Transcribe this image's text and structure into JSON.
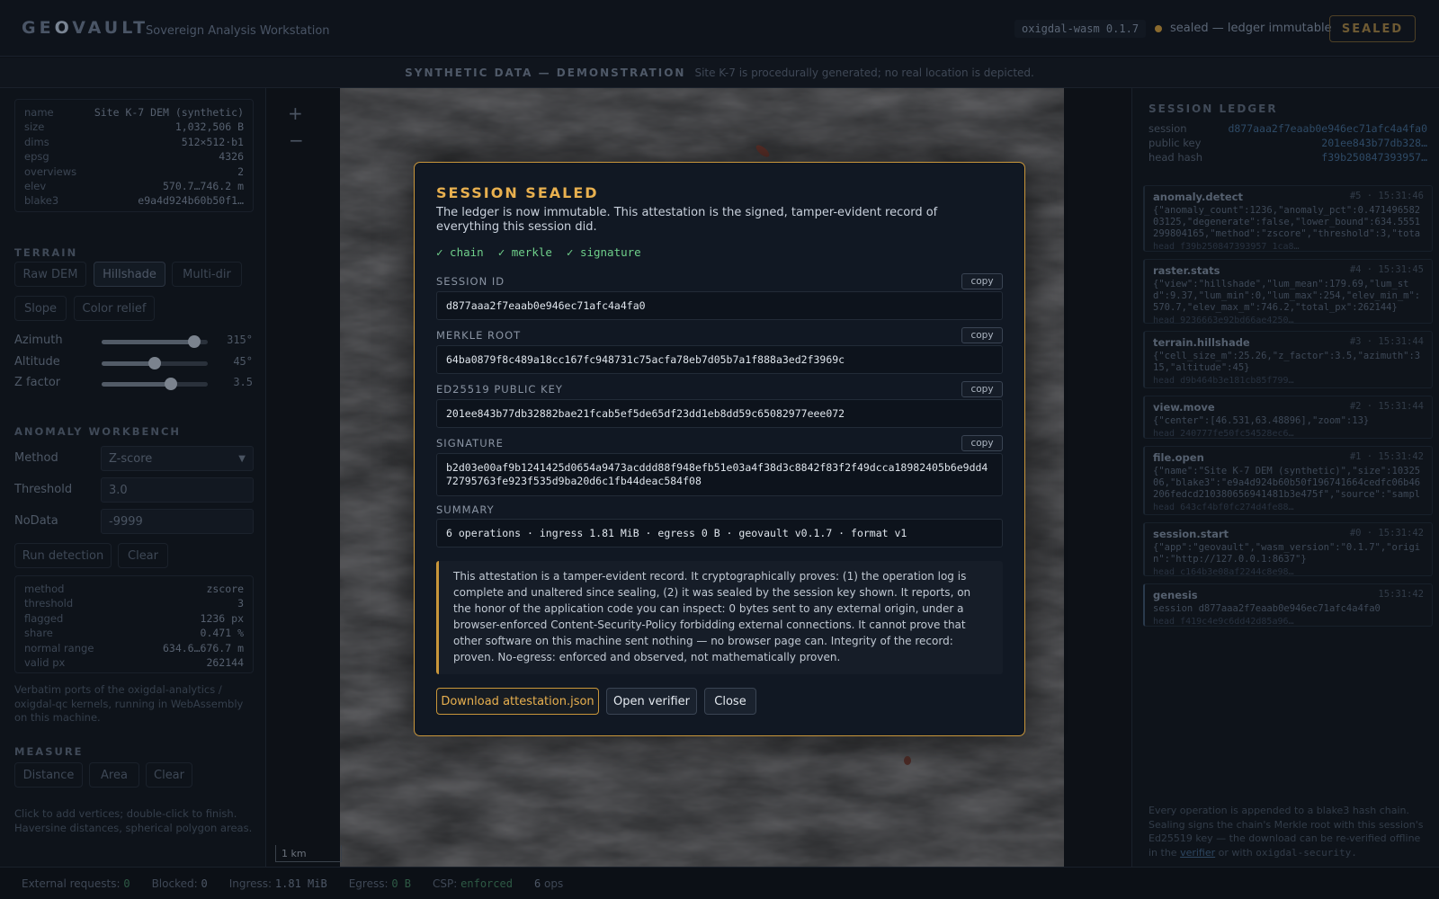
{
  "header": {
    "logo_a": "GE",
    "logo_o": "O",
    "logo_b": "VAULT",
    "subtitle": "Sovereign Analysis Workstation",
    "version_badge": "oxigdal-wasm 0.1.7",
    "status_text": "sealed — ledger immutable",
    "sealed_label": "SEALED"
  },
  "banner": {
    "title": "SYNTHETIC DATA — DEMONSTRATION",
    "text": "Site K-7 is procedurally generated; no real location is depicted."
  },
  "file_meta": [
    {
      "k": "name",
      "v": "Site K-7 DEM (synthetic)"
    },
    {
      "k": "size",
      "v": "1,032,506 B"
    },
    {
      "k": "dims",
      "v": "512×512·b1"
    },
    {
      "k": "epsg",
      "v": "4326"
    },
    {
      "k": "overviews",
      "v": "2"
    },
    {
      "k": "elev",
      "v": "570.7…746.2 m"
    },
    {
      "k": "blake3",
      "v": "e9a4d924b60b50f1…"
    }
  ],
  "terrain": {
    "title": "TERRAIN",
    "modes": [
      "Raw DEM",
      "Hillshade",
      "Multi-dir",
      "Slope",
      "Color relief"
    ],
    "azimuth_label": "Azimuth",
    "azimuth_value": "315°",
    "azimuth_frac": 0.875,
    "altitude_label": "Altitude",
    "altitude_value": "45°",
    "altitude_frac": 0.5,
    "zfactor_label": "Z factor",
    "zfactor_value": "3.5",
    "zfactor_frac": 0.65
  },
  "anomaly": {
    "title": "ANOMALY WORKBENCH",
    "method_label": "Method",
    "method_value": "Z-score",
    "threshold_label": "Threshold",
    "threshold_value": "3.0",
    "nodata_label": "NoData",
    "nodata_value": "-9999",
    "run_label": "Run detection",
    "clear_label": "Clear",
    "results": [
      {
        "k": "method",
        "v": "zscore"
      },
      {
        "k": "threshold",
        "v": "3"
      },
      {
        "k": "flagged",
        "v": "1236 px"
      },
      {
        "k": "share",
        "v": "0.471 %"
      },
      {
        "k": "normal range",
        "v": "634.6…676.7 m"
      },
      {
        "k": "valid px",
        "v": "262144"
      }
    ],
    "note": "Verbatim ports of the oxigdal-analytics / oxigdal-qc kernels, running in WebAssembly on this machine."
  },
  "measure": {
    "title": "MEASURE",
    "distance_label": "Distance",
    "area_label": "Area",
    "clear_label": "Clear",
    "note": "Click to add vertices; double-click to finish. Haversine distances, spherical polygon areas."
  },
  "map": {
    "zoom_in": "+",
    "zoom_out": "−",
    "scale_label": "1 km"
  },
  "ledger": {
    "title": "SESSION LEDGER",
    "session_label": "session",
    "session_value": "d877aaa2f7eaab0e946ec71afc4a4fa0",
    "pubkey_label": "public key",
    "pubkey_value": "201ee843b77db328…",
    "headhash_label": "head hash",
    "headhash_value": "f39b250847393957…",
    "entries": [
      {
        "op": "anomaly.detect",
        "meta": "#5 · 15:31:46",
        "payload": "{\"anomaly_count\":1236,\"anomaly_pct\":0.471496582 03125,\"degenerate\":false,\"lower_bound\":634.5551 299804165,\"method\":\"zscore\",\"threshold\":3,\"tota",
        "head": "head f39b250847393957 1ca8…"
      },
      {
        "op": "raster.stats",
        "meta": "#4 · 15:31:45",
        "payload": "{\"view\":\"hillshade\",\"lum_mean\":179.69,\"lum_st d\":9.37,\"lum_min\":0,\"lum_max\":254,\"elev_min_m\": 570.7,\"elev_max_m\":746.2,\"total_px\":262144}",
        "head": "head 9236663e92bd66ae4250…"
      },
      {
        "op": "terrain.hillshade",
        "meta": "#3 · 15:31:44",
        "payload": "{\"cell_size_m\":25.26,\"z_factor\":3.5,\"azimuth\":3 15,\"altitude\":45}",
        "head": "head d9b464b3e181cb85f799…"
      },
      {
        "op": "view.move",
        "meta": "#2 · 15:31:44",
        "payload": "{\"center\":[46.531,63.48896],\"zoom\":13}",
        "head": "head 240777fe50fc54528ec6…"
      },
      {
        "op": "file.open",
        "meta": "#1 · 15:31:42",
        "payload": "{\"name\":\"Site K-7 DEM (synthetic)\",\"size\":10325 06,\"blake3\":\"e9a4d924b60b50f196741664cedfc06b46 206fedcd210380656941481b3e475f\",\"source\":\"sampl",
        "head": "head 643cf4bf0fc274d4fe88…"
      },
      {
        "op": "session.start",
        "meta": "#0 · 15:31:42",
        "payload": "{\"app\":\"geovault\",\"wasm_version\":\"0.1.7\",\"origi n\":\"http://127.0.0.1:8637\"}",
        "head": "head c164b3e08af2244c8e98…"
      },
      {
        "op": "genesis",
        "meta": "15:31:42",
        "payload": "session d877aaa2f7eaab0e946ec71afc4a4fa0",
        "head": "head f419c4e9c6dd42d85a96…"
      }
    ],
    "foot_text": "Every operation is appended to a blake3 hash chain. Sealing signs the chain's Merkle root with this session's Ed25519 key — the download can be re-verified offline in the",
    "foot_link": "verifier",
    "foot_or": "or with",
    "foot_code": "oxigdal-security."
  },
  "statusbar": {
    "ext_label": "External requests:",
    "ext_value": "0",
    "blocked_label": "Blocked:",
    "blocked_value": "0",
    "ingress_label": "Ingress:",
    "ingress_value": "1.81 MiB",
    "egress_label": "Egress:",
    "egress_value": "0 B",
    "csp_label": "CSP:",
    "csp_value": "enforced",
    "ops_value": "6",
    "ops_label": "ops"
  },
  "modal": {
    "title": "SESSION SEALED",
    "desc": "The ledger is now immutable. This attestation is the signed, tamper-evident record of everything this session did.",
    "check_chain": "✓ chain",
    "check_merkle": "✓ merkle",
    "check_signature": "✓ signature",
    "copy_label": "copy",
    "session_id_label": "SESSION ID",
    "session_id": "d877aaa2f7eaab0e946ec71afc4a4fa0",
    "merkle_label": "MERKLE ROOT",
    "merkle": "64ba0879f8c489a18cc167fc948731c75acfa78eb7d05b7a1f888a3ed2f3969c",
    "pubkey_label": "ED25519 PUBLIC KEY",
    "pubkey": "201ee843b77db32882bae21fcab5ef5de65df23dd1eb8dd59c65082977eee072",
    "signature_label": "SIGNATURE",
    "signature": "b2d03e00af9b1241425d0654a9473acddd88f948efb51e03a4f38d3c8842f83f2f49dcca18982405b6e9dd472795763fe923f535d9ba20d6c1fb44deac584f08",
    "summary_label": "SUMMARY",
    "summary": "6 operations · ingress 1.81 MiB · egress 0 B · geovault v0.1.7 · format v1",
    "note": "This attestation is a tamper-evident record. It cryptographically proves: (1) the operation log is complete and unaltered since sealing, (2) it was sealed by the session key shown. It reports, on the honor of the application code you can inspect: 0 bytes sent to any external origin, under a browser-enforced Content-Security-Policy forbidding external connections. It cannot prove that other software on this machine sent nothing — no browser page can. Integrity of the record: proven. No-egress: enforced and observed, not mathematically proven.",
    "download_label": "Download attestation.json",
    "verifier_label": "Open verifier",
    "close_label": "Close"
  }
}
